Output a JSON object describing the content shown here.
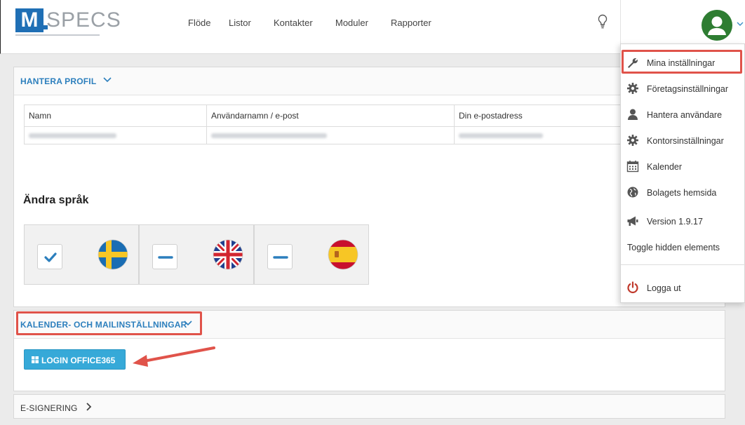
{
  "brand": {
    "logo_letter": "M",
    "logo_word": "SPECS"
  },
  "nav": {
    "items": [
      "Flöde",
      "Listor",
      "Kontakter",
      "Moduler",
      "Rapporter"
    ]
  },
  "profile_panel": {
    "title": "HANTERA PROFIL",
    "table_headers": [
      "Namn",
      "Användarnamn / e-post",
      "Din e-postadress"
    ]
  },
  "language": {
    "title": "Ändra språk",
    "options": [
      {
        "flag": "sweden-flag",
        "selected": true
      },
      {
        "flag": "uk-flag",
        "selected": false
      },
      {
        "flag": "spain-flag",
        "selected": false
      }
    ]
  },
  "calendar_panel": {
    "title": "KALENDER- OCH MAILINSTÄLLNINGAR",
    "login_button": "LOGIN OFFICE365"
  },
  "esign_panel": {
    "title": "E-SIGNERING"
  },
  "user_menu": {
    "items": [
      {
        "label": "Mina inställningar",
        "icon": "wrench-icon"
      },
      {
        "label": "Företagsinställningar",
        "icon": "gear-icon"
      },
      {
        "label": "Hantera användare",
        "icon": "user-icon"
      },
      {
        "label": "Kontorsinställningar",
        "icon": "gear-icon"
      },
      {
        "label": "Kalender",
        "icon": "calendar-icon"
      },
      {
        "label": "Bolagets hemsida",
        "icon": "globe-icon"
      },
      {
        "label": "Version 1.9.17",
        "icon": "megaphone-icon"
      },
      {
        "label": "Toggle hidden elements",
        "icon": ""
      },
      {
        "label": "Logga ut",
        "icon": "power-icon"
      }
    ]
  },
  "colors": {
    "accent": "#2c7fbd",
    "button": "#36a9d8",
    "highlight": "#e0534a",
    "logout": "#c0392b"
  }
}
